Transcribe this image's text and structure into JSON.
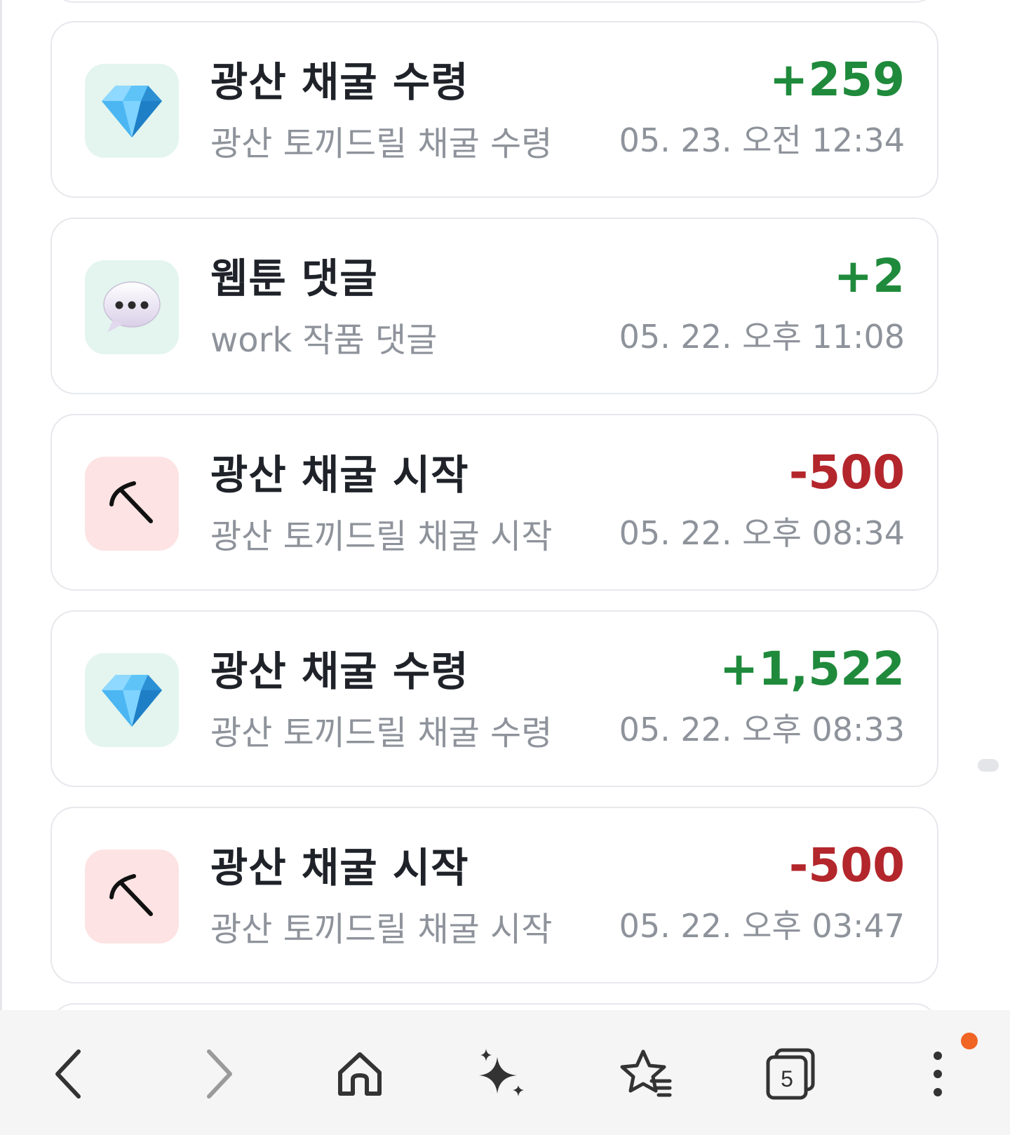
{
  "transactions": [
    {
      "title": "광산 채굴 수령",
      "amount": "+259",
      "description": "광산 토끼드릴 채굴 수령",
      "time": "05. 23. 오전 12:34",
      "icon": "gem-stone-icon"
    },
    {
      "title": "웹툰 댓글",
      "amount": "+2",
      "description": "work 작품 댓글",
      "time": "05. 22. 오후 11:08",
      "icon": "speech-bubble-icon"
    },
    {
      "title": "광산 채굴 시작",
      "amount": "-500",
      "description": "광산 토끼드릴 채굴 시작",
      "time": "05. 22. 오후 08:34",
      "icon": "pickaxe-icon"
    },
    {
      "title": "광산 채굴 수령",
      "amount": "+1,522",
      "description": "광산 토끼드릴 채굴 수령",
      "time": "05. 22. 오후 08:33",
      "icon": "gem-stone-icon"
    },
    {
      "title": "광산 채굴 시작",
      "amount": "-500",
      "description": "광산 토끼드릴 채굴 시작",
      "time": "05. 22. 오후 03:47",
      "icon": "pickaxe-icon"
    }
  ],
  "navbar": {
    "tabs_count": "5",
    "icons": [
      "back-arrow-icon",
      "forward-arrow-icon",
      "home-icon",
      "sparkle-icon",
      "bookmark-star-icon",
      "tabs-icon",
      "more-menu-icon"
    ]
  },
  "colors": {
    "positive": "#1f8a3b",
    "negative": "#b3262b",
    "icon_bg_green": "#e3f5ee",
    "icon_bg_red": "#fde3e3",
    "badge": "#f06424"
  }
}
